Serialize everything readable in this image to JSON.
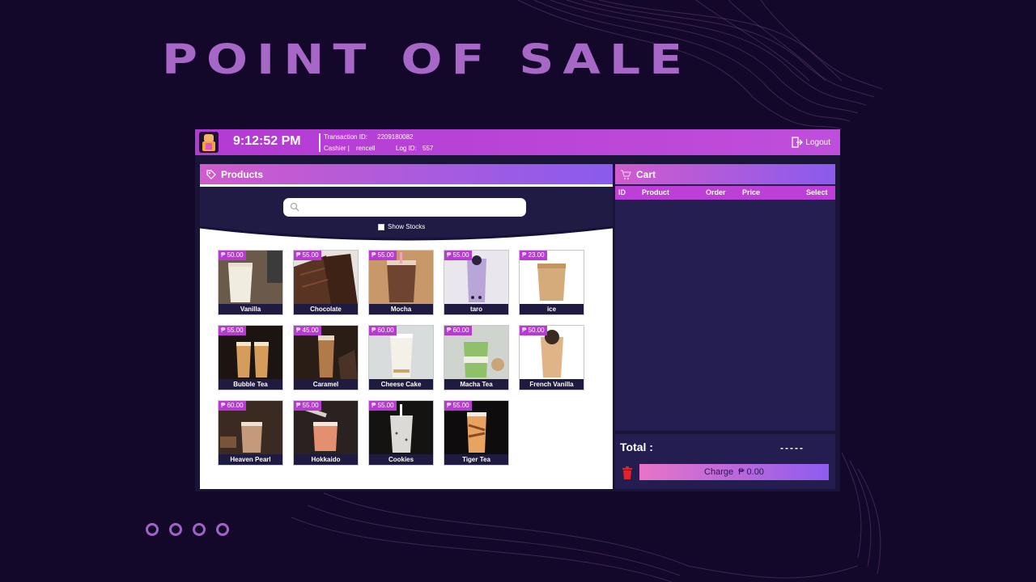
{
  "hero": {
    "title": "POINT OF SALE",
    "dots": [
      1,
      2,
      3,
      4
    ]
  },
  "header": {
    "time": "9:12:52 PM",
    "transaction_label": "Transaction ID:",
    "transaction_id": "2209180082",
    "cashier_label": "Cashier |",
    "cashier_name": "rencell",
    "log_label": "Log ID:",
    "log_id": "557",
    "logout_label": "Logout"
  },
  "products": {
    "title": "Products",
    "search_placeholder": "",
    "show_stocks_label": "Show Stocks",
    "items": [
      {
        "name": "Vanilla",
        "price": "₱ 50.00"
      },
      {
        "name": "Chocolate",
        "price": "₱ 55.00"
      },
      {
        "name": "Mocha",
        "price": "₱ 55.00"
      },
      {
        "name": "taro",
        "price": "₱ 55.00"
      },
      {
        "name": "ice",
        "price": "₱ 23.00"
      },
      {
        "name": "Bubble Tea",
        "price": "₱ 55.00"
      },
      {
        "name": "Caramel",
        "price": "₱ 45.00"
      },
      {
        "name": "Cheese Cake",
        "price": "₱ 60.00"
      },
      {
        "name": "Macha Tea",
        "price": "₱ 60.00"
      },
      {
        "name": "French Vanilla",
        "price": "₱ 50.00"
      },
      {
        "name": "Heaven Pearl",
        "price": "₱ 60.00"
      },
      {
        "name": "Hokkaido",
        "price": "₱ 55.00"
      },
      {
        "name": "Cookies",
        "price": "₱ 55.00"
      },
      {
        "name": "Tiger Tea",
        "price": "₱ 55.00"
      }
    ]
  },
  "cart": {
    "title": "Cart",
    "columns": {
      "id": "ID",
      "product": "Product",
      "order": "Order",
      "price": "Price",
      "select": "Select"
    },
    "rows": []
  },
  "totals": {
    "total_label": "Total :",
    "total_value": "-----",
    "charge_label": "Charge",
    "charge_amount": "₱ 0.00"
  },
  "colors": {
    "accent": "#bd3fd8",
    "gradient_start": "#d05bcc",
    "gradient_end": "#8a5bed",
    "background": "#14082a"
  }
}
